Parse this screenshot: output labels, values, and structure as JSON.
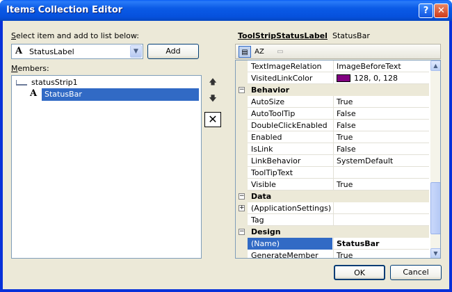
{
  "window": {
    "title": "Items Collection Editor",
    "help_glyph": "?",
    "close_glyph": "✕"
  },
  "left": {
    "select_label_underlined": "S",
    "select_label_rest": "elect item and add to list below:",
    "combo_icon": "A",
    "combo_value": "StatusLabel",
    "add_button": "Add",
    "members_label_underlined": "M",
    "members_label_rest": "embers:",
    "tree": [
      {
        "label": "statusStrip1",
        "icon": "status-strip-icon"
      },
      {
        "label": "StatusBar",
        "icon": "A",
        "selected": true
      }
    ],
    "move_up_glyph": "🡅",
    "move_down_glyph": "🡇",
    "delete_glyph": "✕"
  },
  "props": {
    "title": "ToolStripStatusLabel",
    "subtitle": "StatusBar",
    "rows": [
      {
        "type": "prop",
        "name": "TextImageRelation",
        "value": "ImageBeforeText"
      },
      {
        "type": "prop",
        "name": "VisitedLinkColor",
        "value": "128, 0, 128",
        "swatch": "#800080"
      },
      {
        "type": "cat",
        "name": "Behavior"
      },
      {
        "type": "prop",
        "name": "AutoSize",
        "value": "True"
      },
      {
        "type": "prop",
        "name": "AutoToolTip",
        "value": "False"
      },
      {
        "type": "prop",
        "name": "DoubleClickEnabled",
        "value": "False"
      },
      {
        "type": "prop",
        "name": "Enabled",
        "value": "True"
      },
      {
        "type": "prop",
        "name": "IsLink",
        "value": "False"
      },
      {
        "type": "prop",
        "name": "LinkBehavior",
        "value": "SystemDefault"
      },
      {
        "type": "prop",
        "name": "ToolTipText",
        "value": ""
      },
      {
        "type": "prop",
        "name": "Visible",
        "value": "True"
      },
      {
        "type": "cat",
        "name": "Data"
      },
      {
        "type": "prop",
        "name": "(ApplicationSettings)",
        "value": "",
        "expandable": true
      },
      {
        "type": "prop",
        "name": "Tag",
        "value": ""
      },
      {
        "type": "cat",
        "name": "Design"
      },
      {
        "type": "prop",
        "name": "(Name)",
        "value": "StatusBar",
        "selected": true
      },
      {
        "type": "prop",
        "name": "GenerateMember",
        "value": "True"
      }
    ]
  },
  "footer": {
    "ok": "OK",
    "cancel": "Cancel"
  },
  "colors": {
    "titlebar": "#0a5ae6",
    "selection": "#316ac5",
    "dialog_bg": "#ece9d8"
  }
}
